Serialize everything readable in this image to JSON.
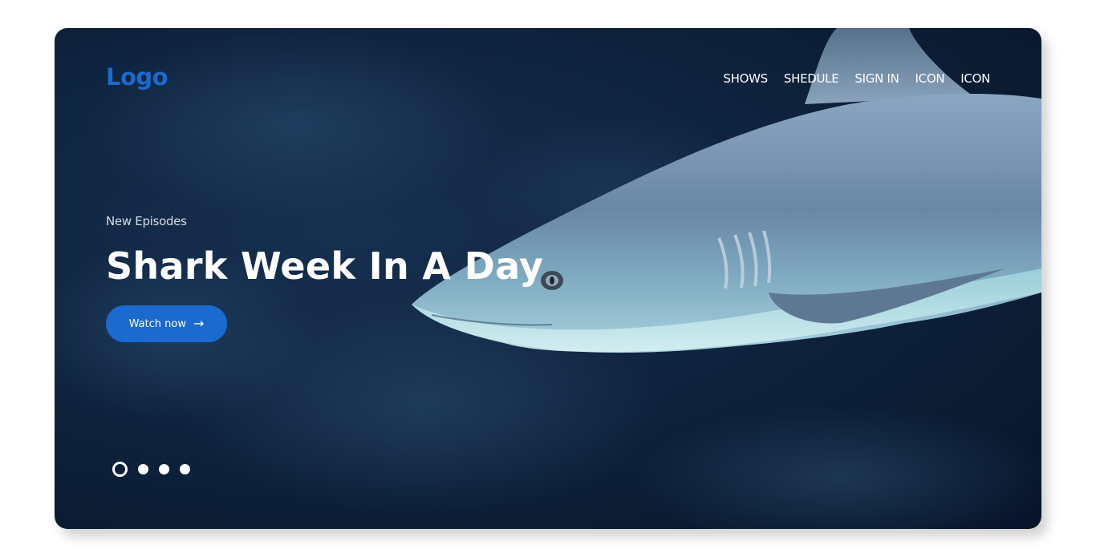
{
  "brand": {
    "logo_text": "Logo"
  },
  "nav": {
    "items": [
      {
        "label": "SHOWS"
      },
      {
        "label": "SHEDULE"
      },
      {
        "label": "SIGN IN"
      },
      {
        "label": "ICON"
      },
      {
        "label": "ICON"
      }
    ]
  },
  "hero": {
    "eyebrow": "New Episodes",
    "title": "Shark Week In A Day",
    "cta_label": "Watch now",
    "cta_icon": "arrow-right-icon",
    "background_image": "shark-underwater-photo"
  },
  "carousel": {
    "slide_count": 4,
    "active_index": 0
  },
  "colors": {
    "accent": "#1b6ad0",
    "text_light": "#ffffff",
    "background_deep": "#0b1c33"
  }
}
